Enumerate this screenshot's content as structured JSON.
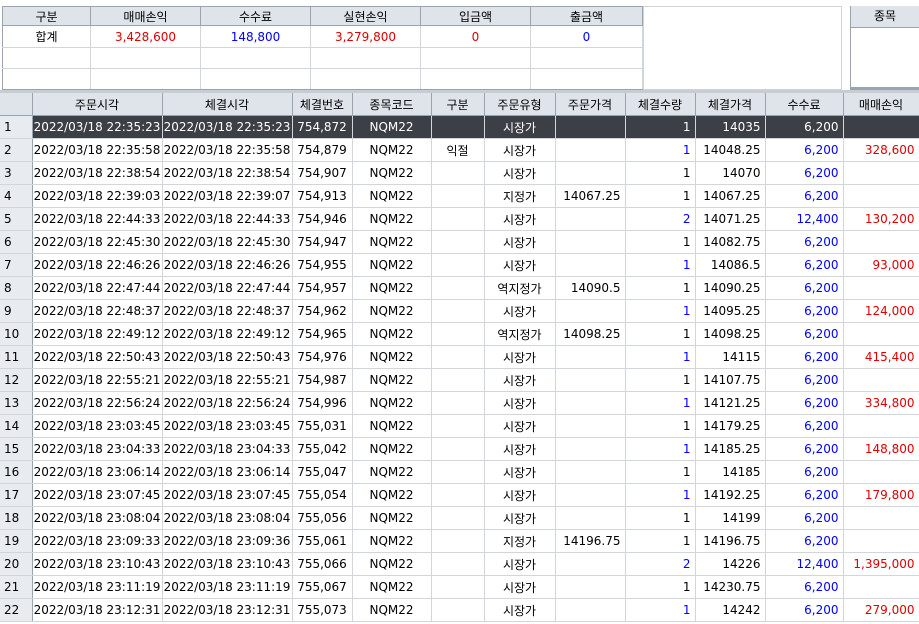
{
  "summary": {
    "headers": [
      "구분",
      "매매손익",
      "수수료",
      "실현손익",
      "입금액",
      "출금액"
    ],
    "total": {
      "label": "합계",
      "trade_pnl": "3,428,600",
      "fee": "148,800",
      "realized_pnl": "3,279,800",
      "deposit": "0",
      "withdrawal": "0"
    }
  },
  "symbol_panel": {
    "header": "종목"
  },
  "grid": {
    "headers": [
      "주문시각",
      "체결시각",
      "체결번호",
      "종목코드",
      "구분",
      "주문유형",
      "주문가격",
      "체결수량",
      "체결가격",
      "수수료",
      "매매손익"
    ],
    "selected_row": 1,
    "rows": [
      {
        "no": "1",
        "order_time": "2022/03/18 22:35:23",
        "fill_time": "2022/03/18 22:35:23",
        "fill_no": "754,872",
        "code": "NQM22",
        "side": "",
        "type": "시장가",
        "order_price": "",
        "qty": "1",
        "fill_price": "14035",
        "fee": "6,200",
        "pnl": ""
      },
      {
        "no": "2",
        "order_time": "2022/03/18 22:35:58",
        "fill_time": "2022/03/18 22:35:58",
        "fill_no": "754,879",
        "code": "NQM22",
        "side": "익절",
        "type": "시장가",
        "order_price": "",
        "qty": "1",
        "fill_price": "14048.25",
        "fee": "6,200",
        "pnl": "328,600"
      },
      {
        "no": "3",
        "order_time": "2022/03/18 22:38:54",
        "fill_time": "2022/03/18 22:38:54",
        "fill_no": "754,907",
        "code": "NQM22",
        "side": "",
        "type": "시장가",
        "order_price": "",
        "qty": "1",
        "fill_price": "14070",
        "fee": "6,200",
        "pnl": ""
      },
      {
        "no": "4",
        "order_time": "2022/03/18 22:39:03",
        "fill_time": "2022/03/18 22:39:07",
        "fill_no": "754,913",
        "code": "NQM22",
        "side": "",
        "type": "지정가",
        "order_price": "14067.25",
        "qty": "1",
        "fill_price": "14067.25",
        "fee": "6,200",
        "pnl": ""
      },
      {
        "no": "5",
        "order_time": "2022/03/18 22:44:33",
        "fill_time": "2022/03/18 22:44:33",
        "fill_no": "754,946",
        "code": "NQM22",
        "side": "",
        "type": "시장가",
        "order_price": "",
        "qty": "2",
        "fill_price": "14071.25",
        "fee": "12,400",
        "pnl": "130,200"
      },
      {
        "no": "6",
        "order_time": "2022/03/18 22:45:30",
        "fill_time": "2022/03/18 22:45:30",
        "fill_no": "754,947",
        "code": "NQM22",
        "side": "",
        "type": "시장가",
        "order_price": "",
        "qty": "1",
        "fill_price": "14082.75",
        "fee": "6,200",
        "pnl": ""
      },
      {
        "no": "7",
        "order_time": "2022/03/18 22:46:26",
        "fill_time": "2022/03/18 22:46:26",
        "fill_no": "754,955",
        "code": "NQM22",
        "side": "",
        "type": "시장가",
        "order_price": "",
        "qty": "1",
        "fill_price": "14086.5",
        "fee": "6,200",
        "pnl": "93,000"
      },
      {
        "no": "8",
        "order_time": "2022/03/18 22:47:44",
        "fill_time": "2022/03/18 22:47:44",
        "fill_no": "754,957",
        "code": "NQM22",
        "side": "",
        "type": "역지정가",
        "order_price": "14090.5",
        "qty": "1",
        "fill_price": "14090.25",
        "fee": "6,200",
        "pnl": ""
      },
      {
        "no": "9",
        "order_time": "2022/03/18 22:48:37",
        "fill_time": "2022/03/18 22:48:37",
        "fill_no": "754,962",
        "code": "NQM22",
        "side": "",
        "type": "시장가",
        "order_price": "",
        "qty": "1",
        "fill_price": "14095.25",
        "fee": "6,200",
        "pnl": "124,000"
      },
      {
        "no": "10",
        "order_time": "2022/03/18 22:49:12",
        "fill_time": "2022/03/18 22:49:12",
        "fill_no": "754,965",
        "code": "NQM22",
        "side": "",
        "type": "역지정가",
        "order_price": "14098.25",
        "qty": "1",
        "fill_price": "14098.25",
        "fee": "6,200",
        "pnl": ""
      },
      {
        "no": "11",
        "order_time": "2022/03/18 22:50:43",
        "fill_time": "2022/03/18 22:50:43",
        "fill_no": "754,976",
        "code": "NQM22",
        "side": "",
        "type": "시장가",
        "order_price": "",
        "qty": "1",
        "fill_price": "14115",
        "fee": "6,200",
        "pnl": "415,400"
      },
      {
        "no": "12",
        "order_time": "2022/03/18 22:55:21",
        "fill_time": "2022/03/18 22:55:21",
        "fill_no": "754,987",
        "code": "NQM22",
        "side": "",
        "type": "시장가",
        "order_price": "",
        "qty": "1",
        "fill_price": "14107.75",
        "fee": "6,200",
        "pnl": ""
      },
      {
        "no": "13",
        "order_time": "2022/03/18 22:56:24",
        "fill_time": "2022/03/18 22:56:24",
        "fill_no": "754,996",
        "code": "NQM22",
        "side": "",
        "type": "시장가",
        "order_price": "",
        "qty": "1",
        "fill_price": "14121.25",
        "fee": "6,200",
        "pnl": "334,800"
      },
      {
        "no": "14",
        "order_time": "2022/03/18 23:03:45",
        "fill_time": "2022/03/18 23:03:45",
        "fill_no": "755,031",
        "code": "NQM22",
        "side": "",
        "type": "시장가",
        "order_price": "",
        "qty": "1",
        "fill_price": "14179.25",
        "fee": "6,200",
        "pnl": ""
      },
      {
        "no": "15",
        "order_time": "2022/03/18 23:04:33",
        "fill_time": "2022/03/18 23:04:33",
        "fill_no": "755,042",
        "code": "NQM22",
        "side": "",
        "type": "시장가",
        "order_price": "",
        "qty": "1",
        "fill_price": "14185.25",
        "fee": "6,200",
        "pnl": "148,800"
      },
      {
        "no": "16",
        "order_time": "2022/03/18 23:06:14",
        "fill_time": "2022/03/18 23:06:14",
        "fill_no": "755,047",
        "code": "NQM22",
        "side": "",
        "type": "시장가",
        "order_price": "",
        "qty": "1",
        "fill_price": "14185",
        "fee": "6,200",
        "pnl": ""
      },
      {
        "no": "17",
        "order_time": "2022/03/18 23:07:45",
        "fill_time": "2022/03/18 23:07:45",
        "fill_no": "755,054",
        "code": "NQM22",
        "side": "",
        "type": "시장가",
        "order_price": "",
        "qty": "1",
        "fill_price": "14192.25",
        "fee": "6,200",
        "pnl": "179,800"
      },
      {
        "no": "18",
        "order_time": "2022/03/18 23:08:04",
        "fill_time": "2022/03/18 23:08:04",
        "fill_no": "755,056",
        "code": "NQM22",
        "side": "",
        "type": "시장가",
        "order_price": "",
        "qty": "1",
        "fill_price": "14199",
        "fee": "6,200",
        "pnl": ""
      },
      {
        "no": "19",
        "order_time": "2022/03/18 23:09:33",
        "fill_time": "2022/03/18 23:09:36",
        "fill_no": "755,061",
        "code": "NQM22",
        "side": "",
        "type": "지정가",
        "order_price": "14196.75",
        "qty": "1",
        "fill_price": "14196.75",
        "fee": "6,200",
        "pnl": ""
      },
      {
        "no": "20",
        "order_time": "2022/03/18 23:10:43",
        "fill_time": "2022/03/18 23:10:43",
        "fill_no": "755,066",
        "code": "NQM22",
        "side": "",
        "type": "시장가",
        "order_price": "",
        "qty": "2",
        "fill_price": "14226",
        "fee": "12,400",
        "pnl": "1,395,000"
      },
      {
        "no": "21",
        "order_time": "2022/03/18 23:11:19",
        "fill_time": "2022/03/18 23:11:19",
        "fill_no": "755,067",
        "code": "NQM22",
        "side": "",
        "type": "시장가",
        "order_price": "",
        "qty": "1",
        "fill_price": "14230.75",
        "fee": "6,200",
        "pnl": ""
      },
      {
        "no": "22",
        "order_time": "2022/03/18 23:12:31",
        "fill_time": "2022/03/18 23:12:31",
        "fill_no": "755,073",
        "code": "NQM22",
        "side": "",
        "type": "시장가",
        "order_price": "",
        "qty": "1",
        "fill_price": "14242",
        "fee": "6,200",
        "pnl": "279,000"
      }
    ]
  },
  "colors": {
    "loss_or_positive_pnl": "#e00000",
    "fee_blue": "#0000ff",
    "header_bg": "#dfe3ea",
    "selected_row_bg": "#3c3f45"
  }
}
